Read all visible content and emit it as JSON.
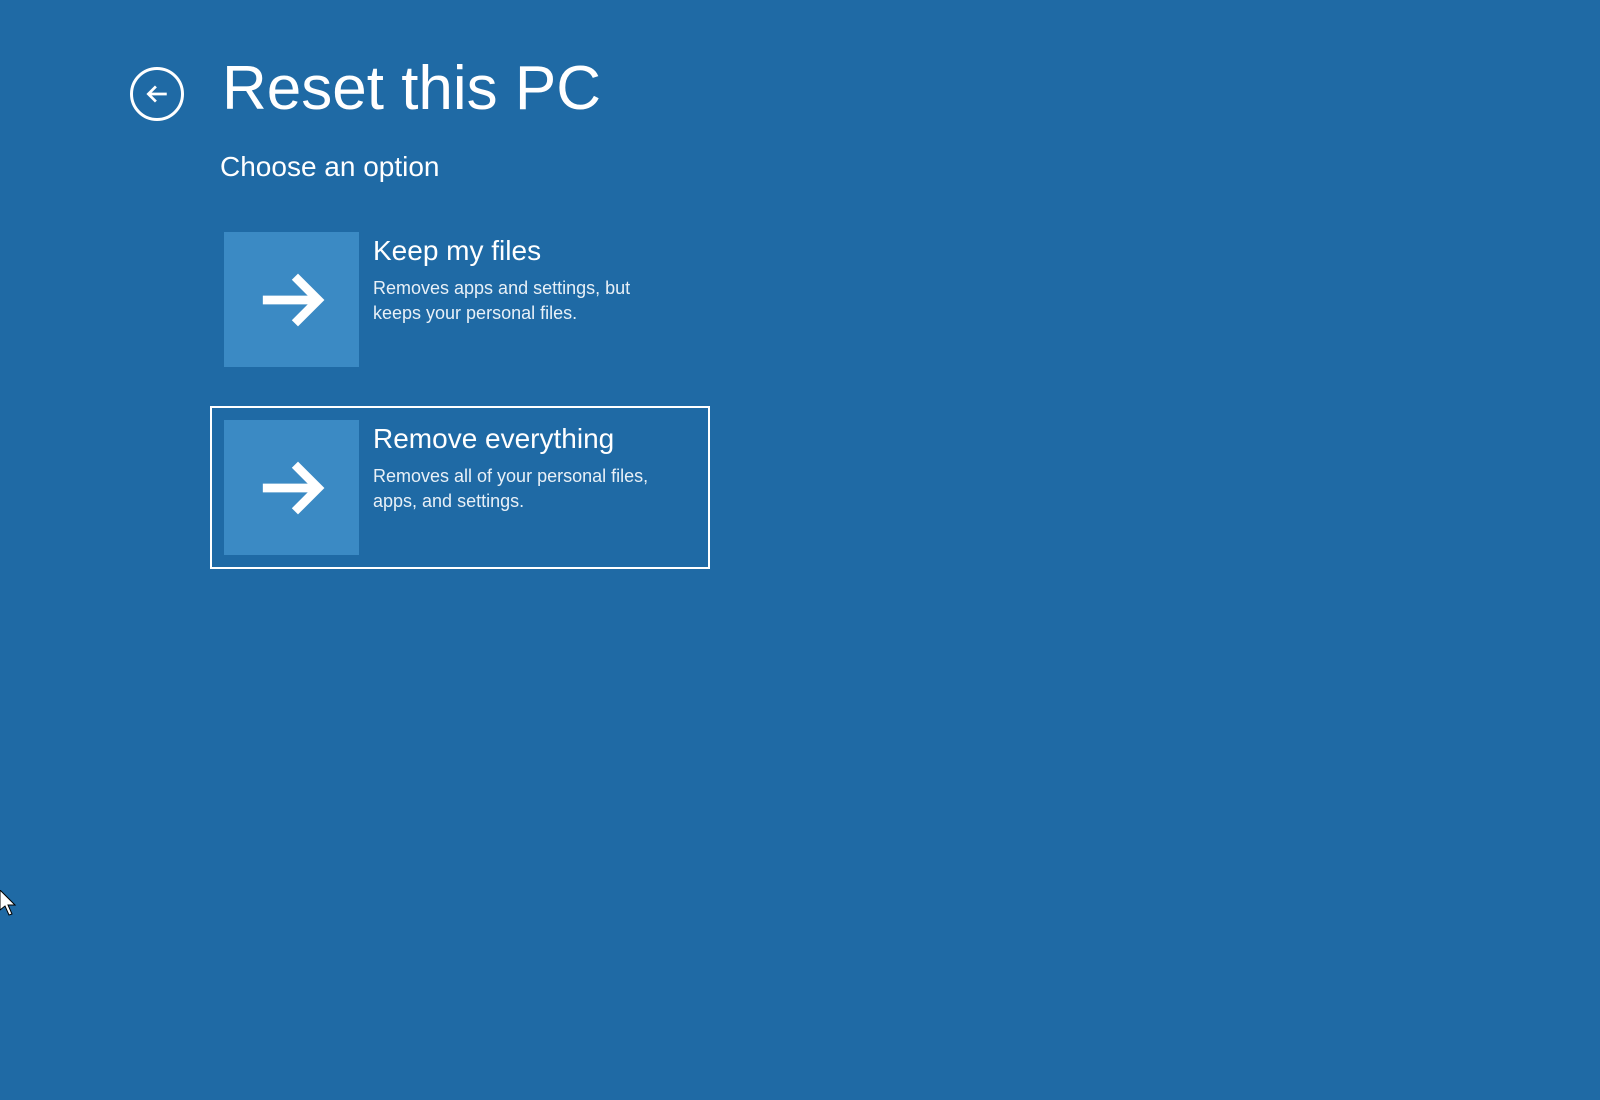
{
  "header": {
    "title": "Reset this PC",
    "subtitle": "Choose an option"
  },
  "options": [
    {
      "title": "Keep my files",
      "desc": "Removes apps and settings, but keeps your personal files.",
      "selected": false
    },
    {
      "title": "Remove everything",
      "desc": "Removes all of your personal files, apps, and settings.",
      "selected": true
    }
  ]
}
